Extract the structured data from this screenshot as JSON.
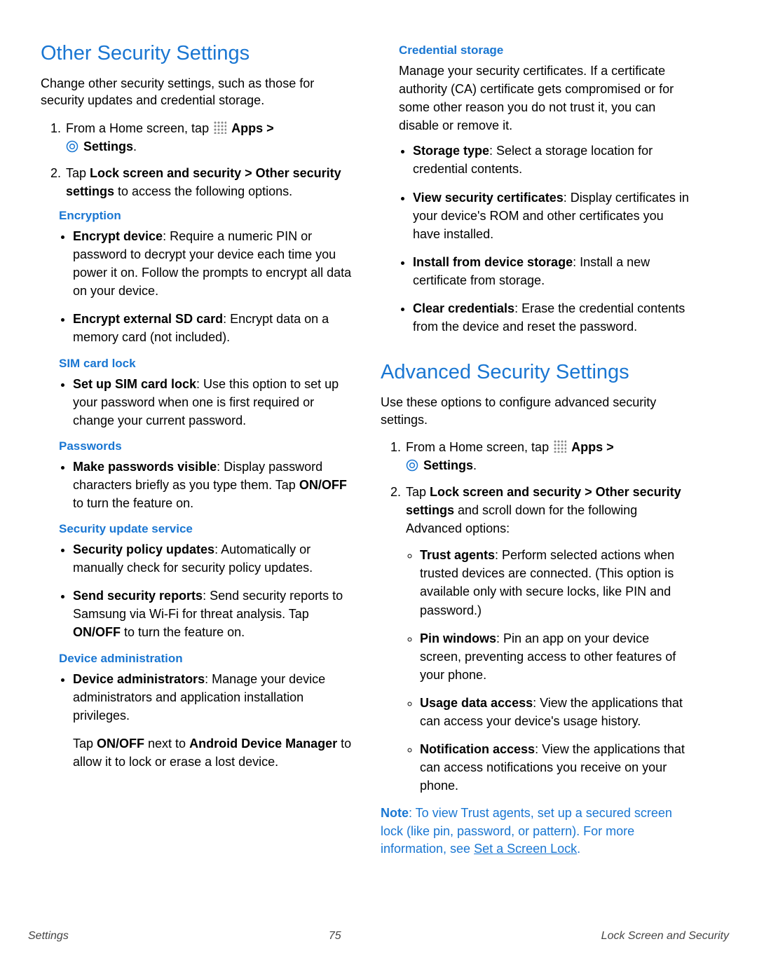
{
  "left": {
    "h2": "Other Security Settings",
    "intro": "Change other security settings, such as those for security updates and credential storage.",
    "step1_pre": "From a Home screen, tap ",
    "apps": "Apps >",
    "settings": "Settings",
    "dot": ".",
    "step2_pre": "Tap ",
    "step2_bold": "Lock screen and security > Other security settings",
    "step2_post": " to access the following options.",
    "sub_encryption": "Encryption",
    "enc1_b": "Encrypt device",
    "enc1_t": ": Require a numeric PIN or password to decrypt your device each time you power it on. Follow the prompts to encrypt all data on your device.",
    "enc2_b": "Encrypt external SD card",
    "enc2_t": ": Encrypt data on a memory card (not included).",
    "sub_sim": "SIM card lock",
    "sim1_b": "Set up SIM card lock",
    "sim1_t": ": Use this option to set up your password when one is first required or change your current password.",
    "sub_pw": "Passwords",
    "pw1_b": "Make passwords visible",
    "pw1_t1": ": Display password characters briefly as you type them. Tap ",
    "pw1_onoff": "ON/OFF",
    "pw1_t2": " to turn the feature on.",
    "sub_sus": "Security update service",
    "sus1_b": "Security policy updates",
    "sus1_t": ": Automatically or manually check for security policy updates.",
    "sus2_b": "Send security reports",
    "sus2_t1": ": Send security reports to Samsung via Wi-Fi for threat analysis. Tap ",
    "sus2_onoff": "ON/OFF",
    "sus2_t2": " to turn the feature on.",
    "sub_da": "Device administration",
    "da1_b": "Device administrators",
    "da1_t": ": Manage your device administrators and application installation privileges.",
    "da2_t1": "Tap ",
    "da2_b1": "ON/OFF",
    "da2_t2": " next to ",
    "da2_b2": "Android Device Manager",
    "da2_t3": " to allow it to lock or erase a lost device."
  },
  "right": {
    "sub_cred": "Credential storage",
    "cred_intro": "Manage your security certificates. If a certificate authority (CA) certificate gets compromised or for some other reason you do not trust it, you can disable or remove it.",
    "cred1_b": "Storage type",
    "cred1_t": ": Select a storage location for credential contents.",
    "cred2_b": "View security certificates",
    "cred2_t": ": Display certificates in your device's ROM and other certificates you have installed.",
    "cred3_b": "Install from device storage",
    "cred3_t": ": Install a new certificate from storage.",
    "cred4_b": "Clear credentials",
    "cred4_t": ": Erase the credential contents from the device and reset the password.",
    "h2": "Advanced Security Settings",
    "intro": "Use these options to configure advanced security settings.",
    "step1_pre": "From a Home screen, tap ",
    "apps": "Apps >",
    "settings": "Settings",
    "dot": ".",
    "step2_pre": "Tap ",
    "step2_bold": "Lock screen and security > Other security settings",
    "step2_post": " and scroll down for the following Advanced options:",
    "adv1_b": "Trust agents",
    "adv1_t": ": Perform selected actions when trusted devices are connected. (This option is available only with secure locks, like PIN and password.)",
    "adv2_b": "Pin windows",
    "adv2_t": ": Pin an app on your device screen, preventing access to other features of your phone.",
    "adv3_b": "Usage data access",
    "adv3_t": ": View the applications that can access your device's usage history.",
    "adv4_b": "Notification access",
    "adv4_t": ": View the applications that can access notifications you receive on your phone.",
    "note_b": "Note",
    "note_t1": ": To view Trust agents, set up a secured screen lock (like pin, password, or pattern). For more information, see ",
    "note_link": "Set a Screen Lock",
    "note_t2": "."
  },
  "footer": {
    "left": "Settings",
    "center": "75",
    "right": "Lock Screen and Security"
  }
}
